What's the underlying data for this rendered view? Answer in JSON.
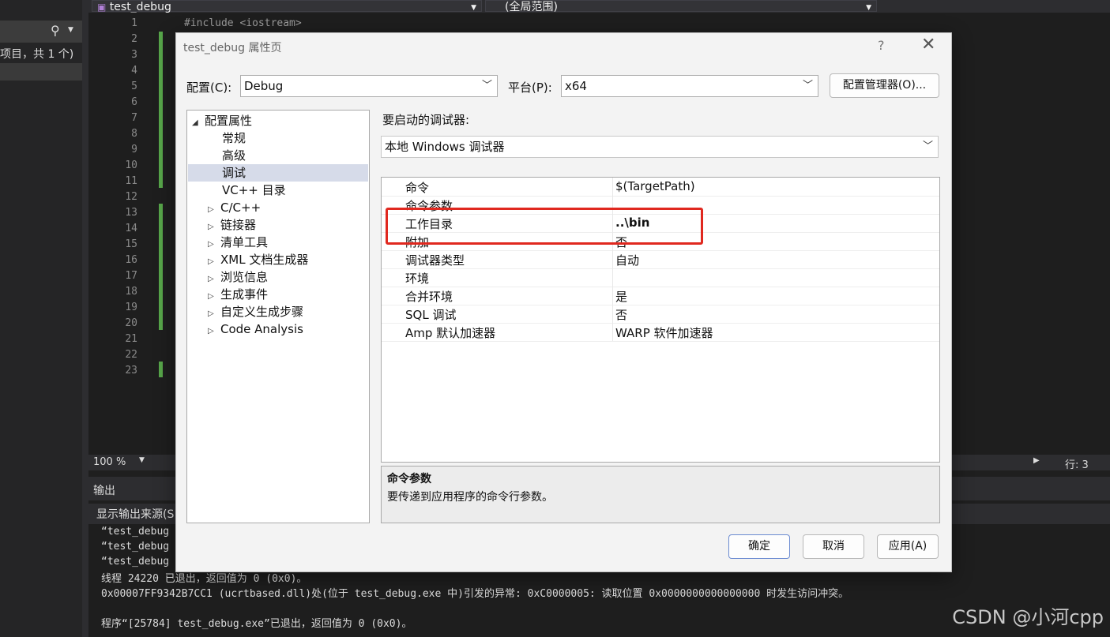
{
  "ide": {
    "doc_combo": "test_debug",
    "scope_combo": "(全局范围)",
    "search_label": "项目，共 1 个)",
    "line_numbers": [
      "1",
      "2",
      "3",
      "4",
      "5",
      "6",
      "7",
      "8",
      "9",
      "10",
      "11",
      "12",
      "13",
      "14",
      "15",
      "16",
      "17",
      "18",
      "19",
      "20",
      "21",
      "22",
      "23"
    ],
    "code_line1": "#include <iostream>",
    "zoom": "100 %",
    "status_line": "行: 3",
    "output_title": "输出",
    "output_source_label": "显示输出来源(S",
    "output_lines": [
      "“test_debug",
      "“test_debug",
      "“test_debug",
      "线程 24220 已退出，返回值为 0 (0x0)。",
      "0x00007FF9342B7CC1 (ucrtbased.dll)处(位于 test_debug.exe 中)引发的异常: 0xC0000005: 读取位置 0x0000000000000000 时发生访问冲突。",
      "",
      "程序“[25784] test_debug.exe”已退出，返回值为 0 (0x0)。"
    ]
  },
  "watermark": "CSDN @小河cpp",
  "dialog": {
    "title": "test_debug 属性页",
    "help": "?",
    "close": "✕",
    "config_label": "配置(C):",
    "config_value": "Debug",
    "platform_label": "平台(P):",
    "platform_value": "x64",
    "config_manager": "配置管理器(O)...",
    "tree": {
      "root": "配置属性",
      "items": [
        {
          "label": "常规",
          "expandable": false
        },
        {
          "label": "高级",
          "expandable": false
        },
        {
          "label": "调试",
          "expandable": false,
          "selected": true
        },
        {
          "label": "VC++ 目录",
          "expandable": false
        },
        {
          "label": "C/C++",
          "expandable": true
        },
        {
          "label": "链接器",
          "expandable": true
        },
        {
          "label": "清单工具",
          "expandable": true
        },
        {
          "label": "XML 文档生成器",
          "expandable": true
        },
        {
          "label": "浏览信息",
          "expandable": true
        },
        {
          "label": "生成事件",
          "expandable": true
        },
        {
          "label": "自定义生成步骤",
          "expandable": true
        },
        {
          "label": "Code Analysis",
          "expandable": true
        }
      ]
    },
    "debugger_label": "要启动的调试器:",
    "debugger_value": "本地 Windows 调试器",
    "properties": [
      {
        "name": "命令",
        "value": "$(TargetPath)"
      },
      {
        "name": "命令参数",
        "value": ""
      },
      {
        "name": "工作目录",
        "value": "..\\bin"
      },
      {
        "name": "附加",
        "value": "否"
      },
      {
        "name": "调试器类型",
        "value": "自动"
      },
      {
        "name": "环境",
        "value": ""
      },
      {
        "name": "合并环境",
        "value": "是"
      },
      {
        "name": "SQL 调试",
        "value": "否"
      },
      {
        "name": "Amp 默认加速器",
        "value": "WARP 软件加速器"
      }
    ],
    "desc_title": "命令参数",
    "desc_text": "要传递到应用程序的命令行参数。",
    "ok": "确定",
    "cancel": "取消",
    "apply": "应用(A)"
  },
  "colors": {
    "highlight_box": "#e0281f",
    "selection": "#d6dbe9",
    "git_green": "#57a64a"
  }
}
